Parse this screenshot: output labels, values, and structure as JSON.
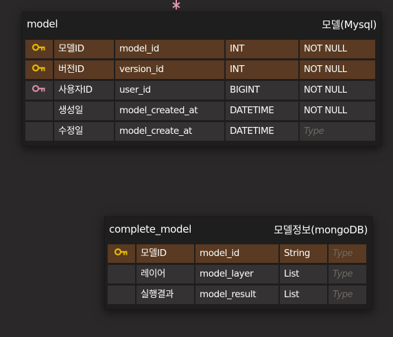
{
  "tables": [
    {
      "physical_name": "model",
      "logical_name": "모델(Mysql)",
      "columns": [
        {
          "key": "primary",
          "logical": "모델ID",
          "physical": "model_id",
          "type": "INT",
          "null": "NOT NULL"
        },
        {
          "key": "primary",
          "logical": "버전ID",
          "physical": "version_id",
          "type": "INT",
          "null": "NOT NULL"
        },
        {
          "key": "foreign",
          "logical": "사용자ID",
          "physical": "user_id",
          "type": "BIGINT",
          "null": "NOT NULL"
        },
        {
          "key": "none",
          "logical": "생성일",
          "physical": "model_created_at",
          "type": "DATETIME",
          "null": "NOT NULL"
        },
        {
          "key": "none",
          "logical": "수정일",
          "physical": "model_create_at",
          "type": "DATETIME",
          "null": "Type"
        }
      ]
    },
    {
      "physical_name": "complete_model",
      "logical_name": "모델정보(mongoDB)",
      "columns": [
        {
          "key": "primary",
          "logical": "모델ID",
          "physical": "model_id",
          "type": "String",
          "null": "Type"
        },
        {
          "key": "none",
          "logical": "레이어",
          "physical": "model_layer",
          "type": "List",
          "null": "Type"
        },
        {
          "key": "none",
          "logical": "실행결과",
          "physical": "model_result",
          "type": "List",
          "null": "Type"
        }
      ]
    }
  ],
  "colors": {
    "background": "#2a2828",
    "table_bg": "#1f1e1e",
    "pk_row": "#5a3a22",
    "normal_row": "#343232",
    "pk_key_icon": "#e6b800",
    "fk_key_icon": "#d48aa0",
    "connector": "#e79ab2"
  },
  "icons": {
    "primary": "key-icon",
    "foreign": "foreign-key-icon",
    "connector": "relationship-connector-icon"
  }
}
